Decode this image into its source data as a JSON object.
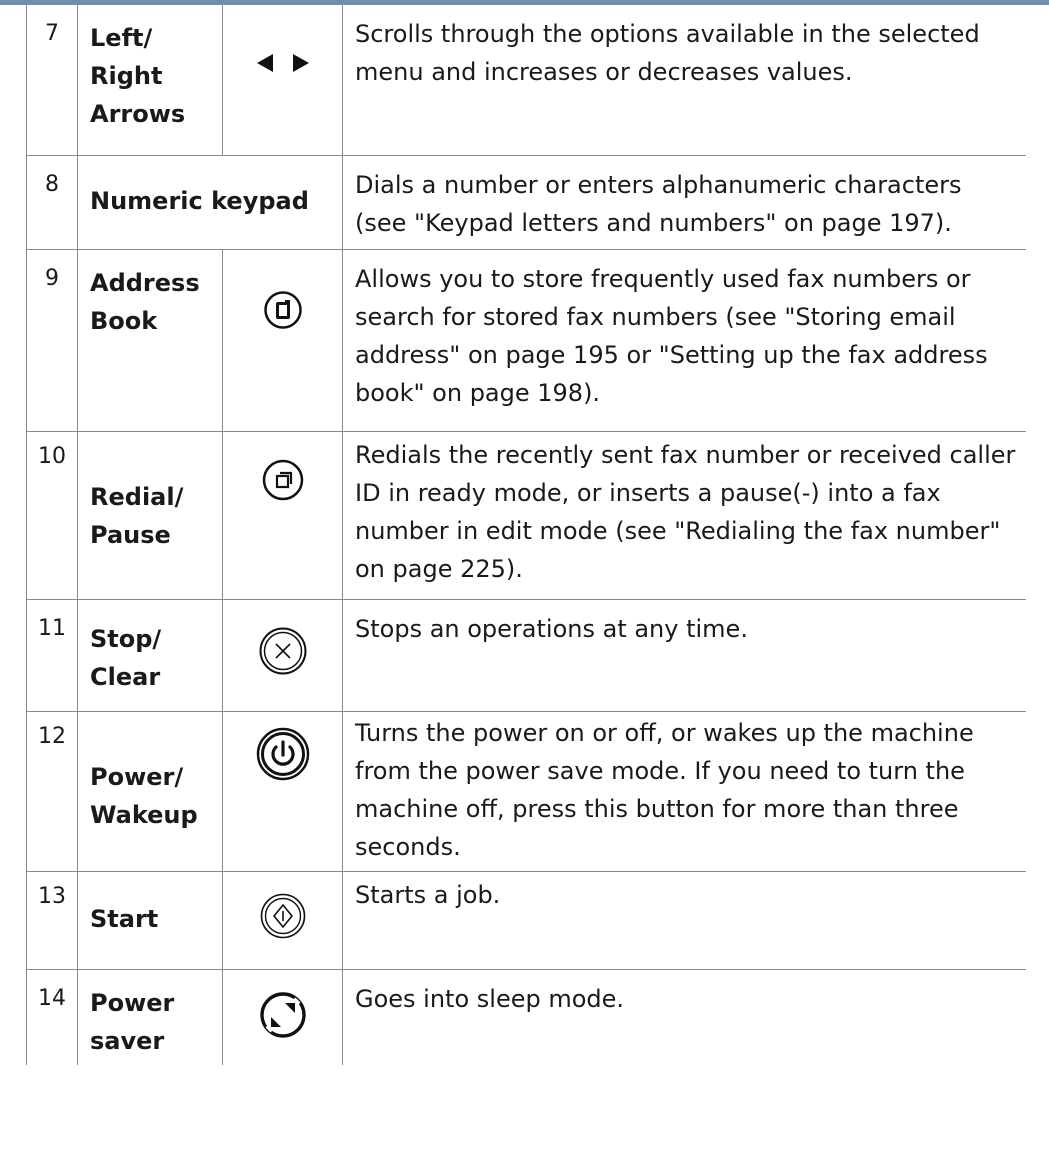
{
  "rows": [
    {
      "num": "7",
      "name": "Left/ Right Arrows",
      "icon": "left-right-arrows-icon",
      "desc": "Scrolls through the options available in the selected menu and increases or decreases values."
    },
    {
      "num": "8",
      "name": "Numeric keypad",
      "icon": "",
      "desc": "Dials a number or enters alphanumeric characters (see \"Keypad letters and numbers\" on page 197)."
    },
    {
      "num": "9",
      "name": "Address Book",
      "icon": "address-book-icon",
      "desc": "Allows you to store frequently used fax numbers or search for stored fax numbers (see \"Storing email address\" on page 195 or \"Setting up the fax address book\" on page 198)."
    },
    {
      "num": "10",
      "name": "Redial/ Pause",
      "icon": "redial-pause-icon",
      "desc": "Redials the recently sent fax number or received caller ID in ready mode, or inserts a pause(-) into a fax number in edit mode (see \"Redialing the fax number\" on page 225)."
    },
    {
      "num": "11",
      "name": "Stop/ Clear",
      "icon": "stop-clear-icon",
      "desc": "Stops an operations at any time."
    },
    {
      "num": "12",
      "name": "Power/ Wakeup",
      "icon": "power-icon",
      "desc": "Turns the power on or off, or wakes up the machine from the power save mode. If you need to turn the machine off, press this button for more than three seconds."
    },
    {
      "num": "13",
      "name": "Start",
      "icon": "start-icon",
      "desc": "Starts a job."
    },
    {
      "num": "14",
      "name": "Power saver",
      "icon": "power-saver-icon",
      "desc": "Goes into sleep mode."
    }
  ]
}
